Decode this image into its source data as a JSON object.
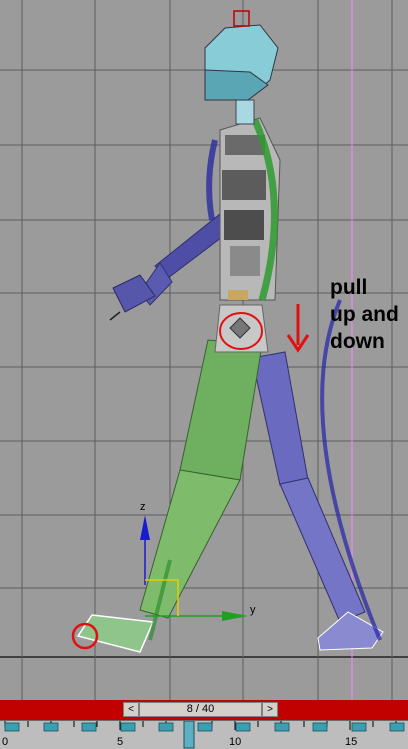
{
  "annotation": {
    "lines": [
      "pull",
      "up and",
      "down"
    ],
    "color": "#000000"
  },
  "timeline": {
    "frame_label": "8 / 40",
    "prev_glyph": "<",
    "next_glyph": ">",
    "tick_labels": [
      "0",
      "5",
      "10",
      "15"
    ],
    "keyframe_color": "#3aa0b0",
    "bar_color": "#c10000"
  },
  "viewport": {
    "background": "#9b9b9b",
    "grid_color": "#5a5a5a",
    "axis_labels": {
      "z": "z",
      "y": "y"
    },
    "icons": [
      "move-gizmo-icon",
      "down-arrow-icon",
      "selection-circle-icon"
    ]
  }
}
